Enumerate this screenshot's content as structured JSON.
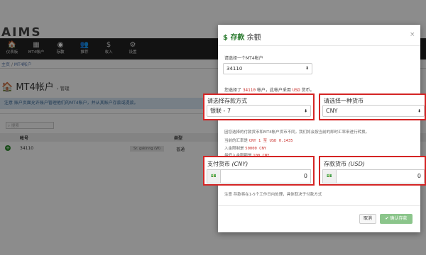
{
  "app": {
    "logo": "AIMS"
  },
  "nav": {
    "items": [
      {
        "icon": "🏠",
        "label": "仪表板"
      },
      {
        "icon": "▦",
        "label": "MT4帐户"
      },
      {
        "icon": "◉",
        "label": "存款"
      },
      {
        "icon": "👥",
        "label": "推荐"
      },
      {
        "icon": "$",
        "label": "收入"
      },
      {
        "icon": "⚙",
        "label": "设置"
      }
    ]
  },
  "breadcrumb": {
    "home": "主页",
    "sep": "/",
    "current": "MT4帐户"
  },
  "page": {
    "title": "MT4帐户",
    "subtitle": "› 管理"
  },
  "notice": {
    "text": "注意 账户页面允许账户管理他们的MT4帐户，并从其账户存款或提款。"
  },
  "search": {
    "placeholder": "搜索"
  },
  "table": {
    "headers": [
      "帐号",
      "类型"
    ],
    "rows": [
      {
        "account": "34110",
        "tag": "Sr. gskinng (W)",
        "type": "普通"
      }
    ]
  },
  "modal": {
    "title_strong": "$ 存款",
    "title_rest": "余额",
    "close": "×",
    "select_account_label": "请选择一个MT4帐户",
    "account_value": "34110",
    "selected_info_pre": "您选择了",
    "selected_info_account": "34110",
    "selected_info_mid": "帐户，此帐户采用",
    "selected_info_currency": "USD",
    "selected_info_post": "货币。",
    "method_label": "请选择存款方式",
    "method_value": "银联 - 7",
    "currency_label": "请选择一种货币",
    "currency_value": "CNY",
    "rate_note": "因您选择的付款货币和MT4帐户货币不同，我们将会按当前的即时汇率来进行转换。",
    "rate_label": "当前的汇率是",
    "rate_value": "CNY 1 至 USD 0.1435",
    "min_label": "入金限制是",
    "min_value": "50000 CNY",
    "max_label": "最低入金限额是",
    "max_value": "100 CNY",
    "pay_label": "支付货币",
    "pay_currency": "(CNY)",
    "pay_value": "0",
    "dep_label": "存款货币",
    "dep_currency": "(USD)",
    "dep_value": "0",
    "processing_note": "注意 存款将在1-5个工作日内处理，具体取决于付款方式",
    "cancel": "取消",
    "confirm": "✔ 确认存款"
  },
  "colors": {
    "accent_green": "#2e7d32",
    "highlight_red": "#d42424",
    "nav_bg": "#222222"
  }
}
